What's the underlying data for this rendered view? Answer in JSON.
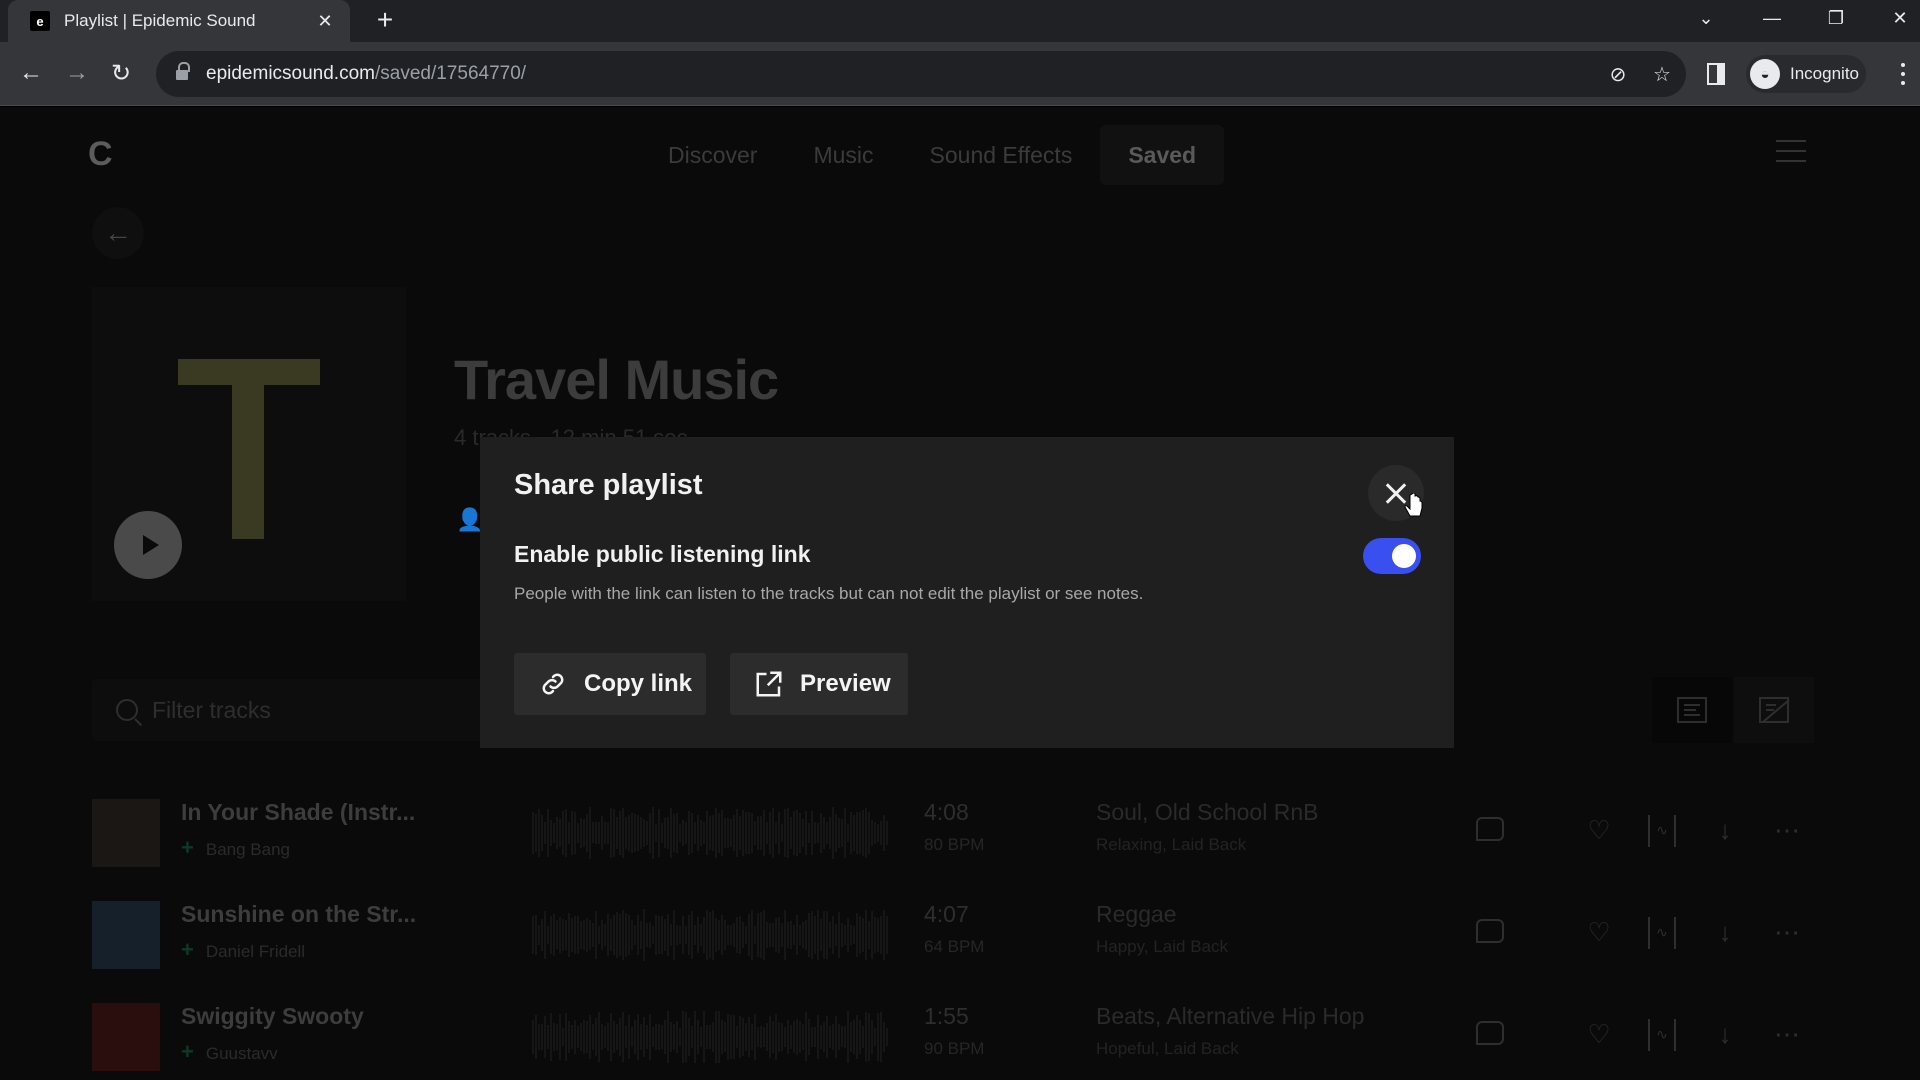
{
  "browser": {
    "tab_title": "Playlist | Epidemic Sound",
    "favicon_letter": "e",
    "tab_close_glyph": "✕",
    "new_tab_glyph": "+",
    "url_host": "epidemicsound.com",
    "url_path": "/saved/17564770/",
    "profile_label": "Incognito",
    "window_controls": {
      "dropdown": "⌄",
      "minimize": "—",
      "restore": "❐",
      "close": "✕"
    },
    "nav": {
      "back": "←",
      "forward": "→",
      "reload": "↻"
    },
    "omni_icons": {
      "tracking_protection": "⊘",
      "bookmark": "☆"
    }
  },
  "site": {
    "logo_glyph": "C",
    "nav": [
      {
        "label": "Discover",
        "active": false
      },
      {
        "label": "Music",
        "active": false
      },
      {
        "label": "Sound Effects",
        "active": false
      },
      {
        "label": "Saved",
        "active": true
      }
    ],
    "back_glyph": "←"
  },
  "playlist": {
    "title": "Travel Music",
    "meta": "4 tracks · 12 min 51 sec",
    "owner_glyph": "👤",
    "filter_placeholder": "Filter tracks"
  },
  "tracks": [
    {
      "title": "In Your Shade (Instr...",
      "artist": "Bang Bang",
      "length": "4:08",
      "bpm": "80 BPM",
      "genres": "Soul, Old School RnB",
      "moods": "Relaxing, Laid Back",
      "thumb_color": "#1a1714"
    },
    {
      "title": "Sunshine on the Str...",
      "artist": "Daniel Fridell",
      "length": "4:07",
      "bpm": "64 BPM",
      "genres": "Reggae",
      "moods": "Happy, Laid Back",
      "thumb_color": "#15202a"
    },
    {
      "title": "Swiggity Swooty",
      "artist": "Guustavv",
      "length": "1:55",
      "bpm": "90 BPM",
      "genres": "Beats, Alternative Hip Hop",
      "moods": "Hopeful, Laid Back",
      "thumb_color": "#2a0d0d"
    }
  ],
  "track_actions": {
    "add_glyph": "+",
    "favorite_glyph": "♡",
    "stems_glyph": "∿",
    "download_glyph": "↓",
    "more_glyph": "⋯"
  },
  "modal": {
    "title": "Share playlist",
    "option_label": "Enable public listening link",
    "option_description": "People with the link can listen to the tracks but can not edit the playlist or see notes.",
    "toggle_on": true,
    "toggle_color": "#3a4ff0",
    "copy_link_label": "Copy link",
    "preview_label": "Preview"
  }
}
